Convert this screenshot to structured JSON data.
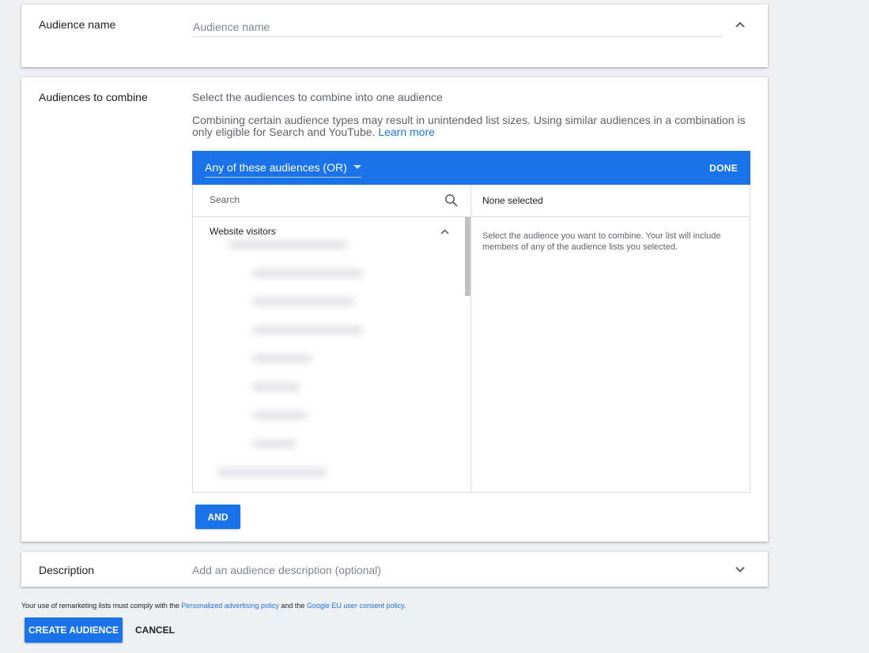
{
  "colors": {
    "accent": "#1a73e8",
    "background": "#eff0f2"
  },
  "audience_name": {
    "label": "Audience name",
    "placeholder": "Audience name",
    "value": "",
    "toggle_icon": "chevron-up-icon"
  },
  "combine": {
    "label": "Audiences to combine",
    "title": "Select the audiences to combine into one audience",
    "note": "Combining certain audience types may result in unintended list sizes. Using similar audiences in a combination is only eligible for Search and YouTube.",
    "learn_more": "Learn more",
    "picker": {
      "mode_label": "Any of these audiences (OR)",
      "done_label": "DONE",
      "search_placeholder": "Search",
      "group_label": "Website visitors",
      "selected_header": "None selected",
      "helper_text": "Select the audience you want to combine. Your list will include members of any of the audience lists you selected."
    },
    "and_label": "AND"
  },
  "description": {
    "label": "Description",
    "placeholder": "Add an audience description (optional)",
    "toggle_icon": "chevron-down-icon"
  },
  "policy": {
    "prefix": "Your use of remarketing lists must comply with the",
    "link1": "Personalized advertising policy",
    "middle": "and the",
    "link2": "Google EU user consent policy",
    "suffix": "."
  },
  "actions": {
    "create_label": "CREATE AUDIENCE",
    "cancel_label": "CANCEL"
  }
}
